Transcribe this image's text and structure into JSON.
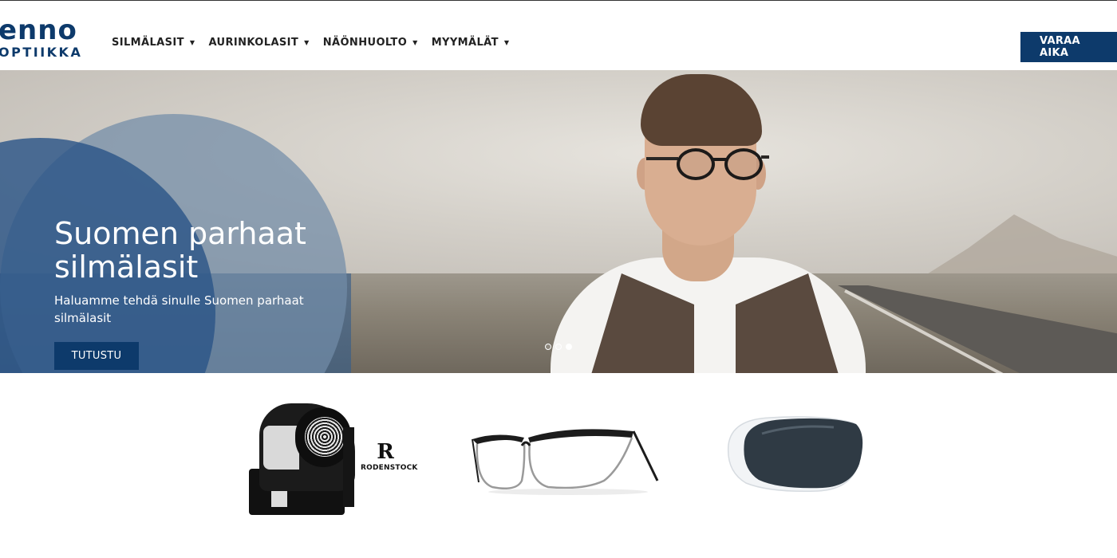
{
  "brand": {
    "line1": "enno",
    "line2": "OPTIIKKA"
  },
  "nav": [
    {
      "label": "SILMÄLASIT"
    },
    {
      "label": "AURINKOLASIT"
    },
    {
      "label": "NÄÖNHUOLTO"
    },
    {
      "label": "MYYMÄLÄT"
    }
  ],
  "cta": {
    "label": "VARAA AIKA",
    "icon": "clock-icon"
  },
  "hero": {
    "title": "Suomen parhaat silmälasit",
    "subtitle": "Haluamme tehdä sinulle Suomen parhaat silmälasit",
    "button": "TUTUSTU",
    "slide_count": 3,
    "active_slide": 3
  },
  "products": {
    "device_brand": "RODENSTOCK",
    "device_brand_mark": "R"
  },
  "colors": {
    "brand_blue": "#0d3a6b",
    "circle_light": "#718ca8",
    "circle_dark": "#2c5687"
  }
}
